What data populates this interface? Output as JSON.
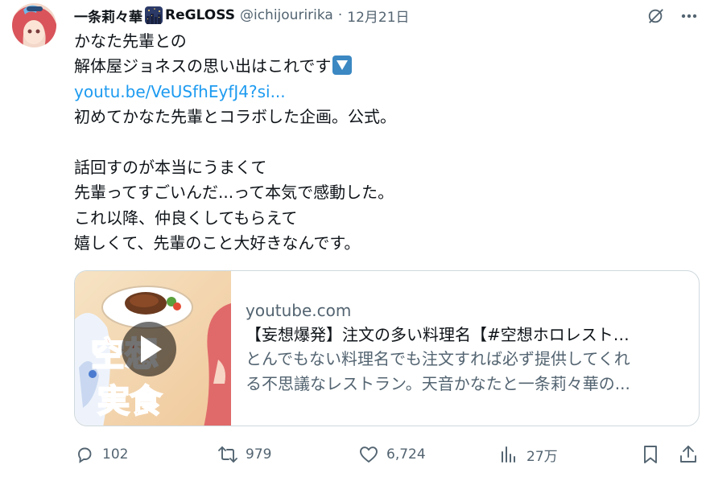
{
  "tweet": {
    "display_name": "一条莉々華",
    "group_name": "ReGLOSS",
    "handle": "@ichijouririka",
    "separator": "·",
    "date": "12月21日",
    "lines": [
      "かなた先輩との",
      "解体屋ジョネスの思い出はこれです",
      "youtu.be/VeUSfhEyfJ4?si...",
      "初めてかなた先輩とコラボした企画。公式。",
      "",
      "話回すのが本当にうまくて",
      "先輩ってすごいんだ...って本気で感動した。",
      "これ以降、仲良くしてもらえて",
      "嬉しくて、先輩のこと大好きなんです。"
    ]
  },
  "card": {
    "domain": "youtube.com",
    "title": "【妄想爆発】注文の多い料理名【#空想ホロレスト…",
    "desc_line1": "とんでもない料理名でも注文すれば必ず提供してくれ",
    "desc_line2": "る不思議なレストラン。天音かなたと一条莉々華の...",
    "thumb_text_top": "空想",
    "thumb_text_bottom": "実食"
  },
  "actions": {
    "replies": "102",
    "reposts": "979",
    "likes": "6,724",
    "views": "27万"
  },
  "icons": {
    "grok": "grok-icon",
    "more": "more-icon",
    "reply": "reply-icon",
    "repost": "repost-icon",
    "like": "like-icon",
    "views": "views-icon",
    "bookmark": "bookmark-icon",
    "share": "share-icon",
    "down": "down-arrow-emoji-icon",
    "play": "play-icon"
  },
  "colors": {
    "link": "#1d9bf0",
    "secondary": "#536471",
    "primary": "#0f1419",
    "border": "#cfd9de"
  }
}
